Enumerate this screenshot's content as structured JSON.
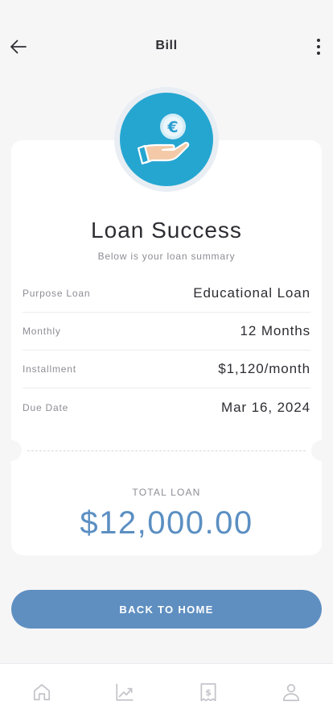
{
  "header": {
    "title": "Bill",
    "back_icon": "arrow-left-icon",
    "more_icon": "more-vertical-icon"
  },
  "hero": {
    "icon": "hand-euro-coin-icon",
    "coin_symbol": "€"
  },
  "summary": {
    "title": "Loan Success",
    "subtitle": "Below is your loan summary",
    "rows": [
      {
        "label": "Purpose Loan",
        "value": "Educational Loan"
      },
      {
        "label": "Monthly",
        "value": "12 Months"
      },
      {
        "label": "Installment",
        "value": "$1,120/month"
      },
      {
        "label": "Due Date",
        "value": "Mar 16, 2024"
      }
    ]
  },
  "total": {
    "label": "TOTAL LOAN",
    "value": "$12,000.00"
  },
  "cta": {
    "label": "BACK TO HOME"
  },
  "nav": {
    "items": [
      "home-icon",
      "chart-icon",
      "bill-icon",
      "profile-icon"
    ]
  },
  "colors": {
    "accent": "#5f8fc1",
    "badge": "#25a6d1",
    "total": "#5b8fc2",
    "background": "#f6f6f7"
  }
}
